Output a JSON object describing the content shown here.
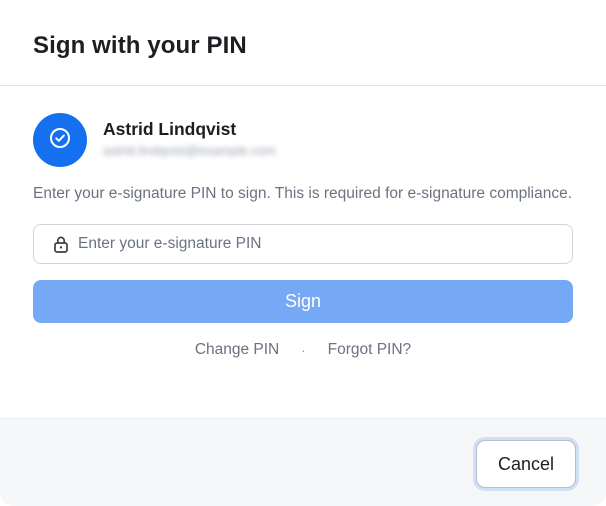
{
  "dialog": {
    "title": "Sign with your PIN"
  },
  "user": {
    "avatar_icon": "check-circle-icon",
    "name": "Astrid Lindqvist",
    "email": "astrid.lindqvist@example.com"
  },
  "description": "Enter your e-signature PIN to sign. This is required for e-signature compliance.",
  "pin_field": {
    "icon": "lock-icon",
    "value": "",
    "placeholder": "Enter your e-signature PIN"
  },
  "sign_button": {
    "label": "Sign"
  },
  "links": {
    "change_pin": "Change PIN",
    "separator": "·",
    "forgot_pin": "Forgot PIN?"
  },
  "footer": {
    "cancel_label": "Cancel"
  },
  "colors": {
    "accent": "#1570ef",
    "sign_button_disabled": "#75a9f5",
    "footer_bg": "#f6f7f9"
  }
}
